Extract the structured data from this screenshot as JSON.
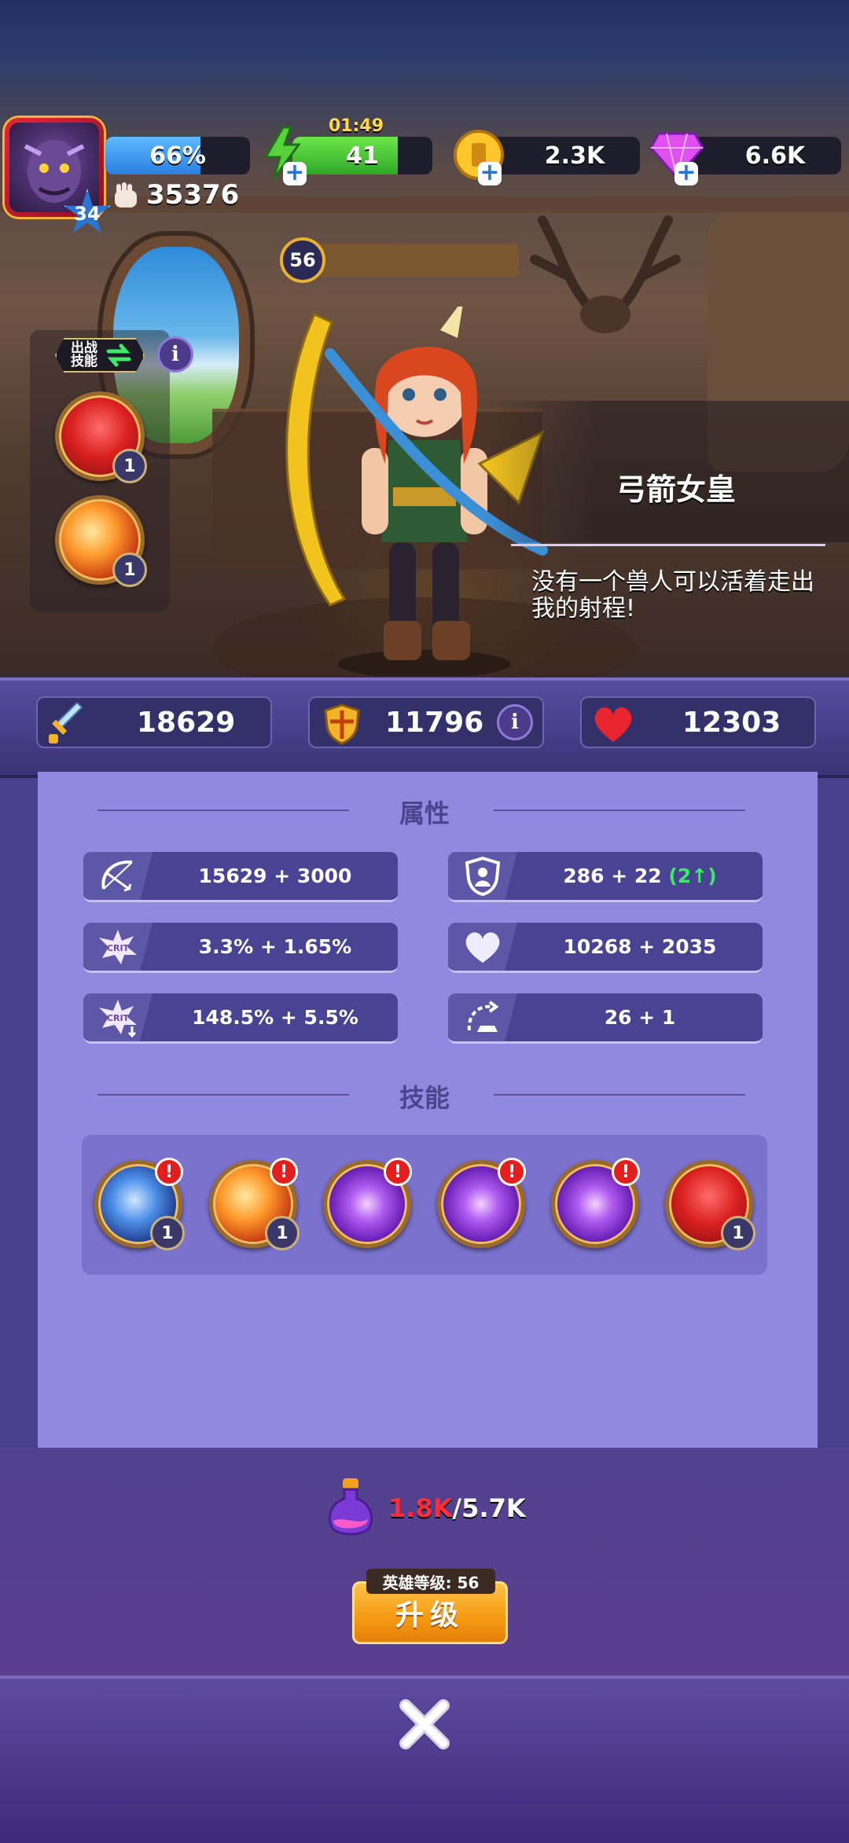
{
  "hud": {
    "profile_level": "34",
    "hp_percent_text": "66%",
    "hp_fill": 0.66,
    "power": "35376",
    "energy_timer": "01:49",
    "energy": "41",
    "energy_fill": 0.75,
    "gold": "2.3K",
    "gems": "6.6K"
  },
  "hero": {
    "level": "56",
    "name": "弓箭女皇",
    "quote": "没有一个兽人可以活着走出我的射程!",
    "skill_tag": "出战技能",
    "equipped_skills": [
      {
        "icon": "red-twins-icon",
        "count": "1"
      },
      {
        "icon": "fire-burst-icon",
        "count": "1"
      }
    ]
  },
  "stats": {
    "attack": "18629",
    "defense": "11796",
    "health": "12303"
  },
  "attributes": {
    "title": "属性",
    "items": [
      {
        "icon": "bow-icon",
        "value": "15629 + 3000"
      },
      {
        "icon": "shield-figure-icon",
        "value": "286 + 22",
        "bonus": "(2↑)"
      },
      {
        "icon": "crit-icon",
        "value": "3.3% + 1.65%"
      },
      {
        "icon": "heart-icon",
        "value": "10268 + 2035"
      },
      {
        "icon": "crit-damage-icon",
        "value": "148.5% + 5.5%"
      },
      {
        "icon": "speed-icon",
        "value": "26 + 1"
      }
    ]
  },
  "skills": {
    "title": "技能",
    "items": [
      {
        "icon": "ice-arrow-icon",
        "count": "1",
        "alert": "!"
      },
      {
        "icon": "fire-burst-icon",
        "count": "1",
        "alert": "!"
      },
      {
        "icon": "arcane-orb-icon",
        "alert": "!"
      },
      {
        "icon": "piercing-arrow-icon",
        "alert": "!"
      },
      {
        "icon": "arcane-ring-icon",
        "alert": "!"
      },
      {
        "icon": "red-twins-icon",
        "count": "1"
      }
    ]
  },
  "upgrade": {
    "cost_current": "1.8K",
    "cost_total": "/5.7K",
    "hero_level_label": "英雄等级: 56",
    "button_label": "升级"
  },
  "colors": {
    "panel": "#9189e0",
    "attr_row": "#4a4292",
    "button": "#f59a12",
    "cost_short": "#ff2d3a"
  }
}
